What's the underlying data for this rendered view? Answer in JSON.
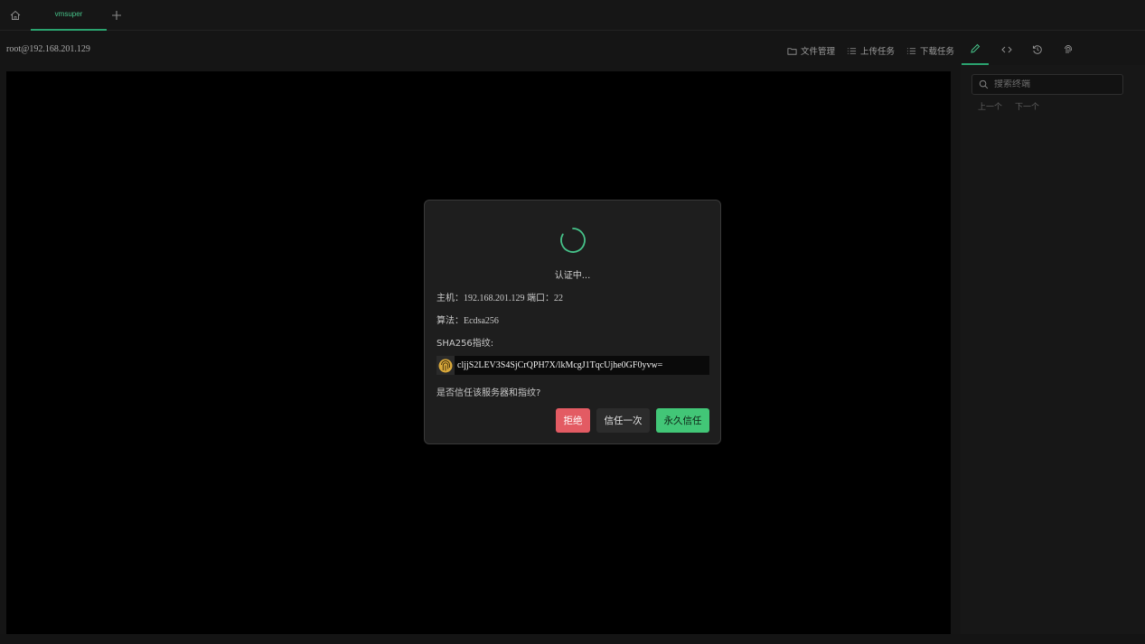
{
  "tabs": [
    {
      "label": "vmsuper",
      "active": true
    }
  ],
  "toolbar": {
    "host": "root@192.168.201.129",
    "file_manager": "文件管理",
    "upload_tasks": "上传任务",
    "download_tasks": "下载任务"
  },
  "search": {
    "placeholder": "搜索终端",
    "prev": "上一个",
    "next": "下一个"
  },
  "dialog": {
    "status": "认证中...",
    "host_line": "主机：192.168.201.129 端口：22",
    "algo_line": "算法：Ecdsa256",
    "fp_label": "SHA256指纹:",
    "fingerprint": "cljjS2LEV3S4SjCrQPH7X/lkMcgJ1TqcUjhe0GF0yvw=",
    "question": "是否信任该服务器和指纹?",
    "btn_reject": "拒绝",
    "btn_once": "信任一次",
    "btn_forever": "永久信任"
  },
  "colors": {
    "accent": "#2aa36f",
    "danger": "#e35b63",
    "success": "#42c677"
  },
  "icons": [
    "home-icon",
    "plus-icon",
    "folder-icon",
    "list-icon",
    "pencil-icon",
    "code-icon",
    "history-icon",
    "fingerprint-icon",
    "search-icon",
    "spinner-icon"
  ]
}
